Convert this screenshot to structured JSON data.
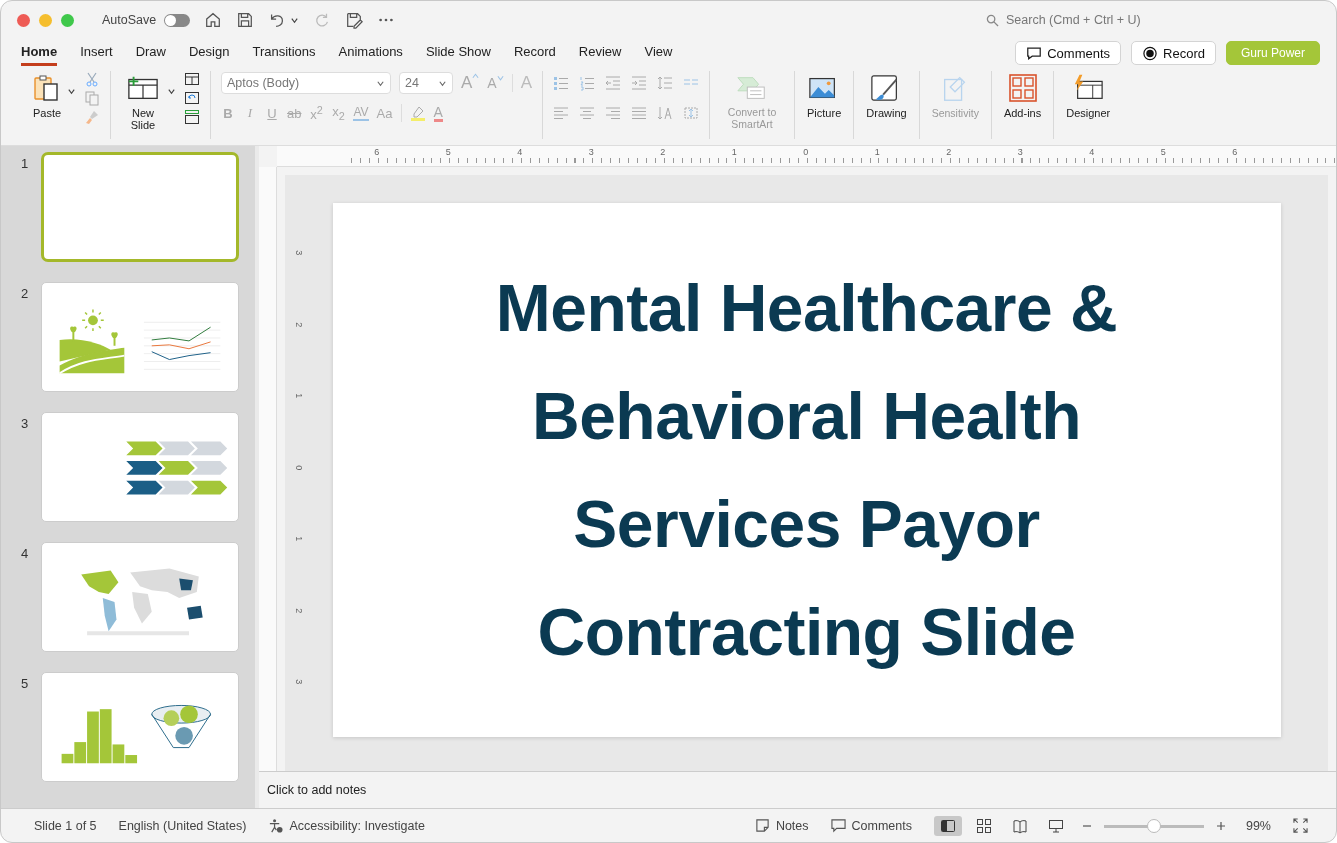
{
  "window": {
    "autosave_label": "AutoSave",
    "autosave_on": false,
    "search_placeholder": "Search (Cmd + Ctrl + U)"
  },
  "tabs": [
    {
      "label": "Home",
      "selected": true
    },
    {
      "label": "Insert",
      "selected": false
    },
    {
      "label": "Draw",
      "selected": false
    },
    {
      "label": "Design",
      "selected": false
    },
    {
      "label": "Transitions",
      "selected": false
    },
    {
      "label": "Animations",
      "selected": false
    },
    {
      "label": "Slide Show",
      "selected": false
    },
    {
      "label": "Record",
      "selected": false
    },
    {
      "label": "Review",
      "selected": false
    },
    {
      "label": "View",
      "selected": false
    }
  ],
  "header_buttons": [
    {
      "label": "Comments",
      "kind": "comments"
    },
    {
      "label": "Record",
      "kind": "record"
    },
    {
      "label": "Guru Power",
      "kind": "primary"
    }
  ],
  "ribbon": {
    "paste": "Paste",
    "new_slide": "New Slide",
    "font": "Aptos (Body)",
    "font_size": "24",
    "font_buttons": [
      {
        "label": "B",
        "kind": "bold"
      },
      {
        "label": "I",
        "kind": "italic"
      },
      {
        "label": "U",
        "kind": "underline"
      },
      {
        "label": "ab",
        "kind": "strike"
      },
      {
        "label": "x$^{2}$",
        "kind": "plain"
      },
      {
        "label": "x$_{2}$",
        "kind": "plain"
      },
      {
        "label": "AV",
        "kind": "spacing"
      },
      {
        "label": "Aa",
        "kind": "case"
      }
    ],
    "grow": "A",
    "shrink": "A",
    "clear": "A",
    "font_color": "A",
    "convert": "Convert to SmartArt",
    "convert_disabled": true,
    "big_buttons": [
      {
        "label": "Picture",
        "kind": "picture",
        "disabled": false
      },
      {
        "label": "Drawing",
        "kind": "drawing",
        "disabled": false
      },
      {
        "label": "Sensitivity",
        "kind": "sensitivity",
        "disabled": true
      },
      {
        "label": "Add-ins",
        "kind": "addins",
        "disabled": false
      },
      {
        "label": "Designer",
        "kind": "designer",
        "disabled": false
      }
    ]
  },
  "slides": [
    {
      "number": "1",
      "selected": true,
      "kind": "blank"
    },
    {
      "number": "2",
      "selected": false,
      "kind": "landscape"
    },
    {
      "number": "3",
      "selected": false,
      "kind": "chevrons"
    },
    {
      "number": "4",
      "selected": false,
      "kind": "map"
    },
    {
      "number": "5",
      "selected": false,
      "kind": "funnel"
    }
  ],
  "ruler": {
    "horizontal": [
      "6",
      "5",
      "4",
      "3",
      "2",
      "1",
      "0",
      "1",
      "2",
      "3",
      "4",
      "5",
      "6"
    ],
    "vertical": [
      "3",
      "2",
      "1",
      "0",
      "1",
      "2",
      "3"
    ]
  },
  "slide": {
    "title": "Mental Healthcare & Behavioral Health Services Payor Contracting Slide"
  },
  "notes": {
    "placeholder": "Click to add notes"
  },
  "status_bar": {
    "slide_info": "Slide 1 of 5",
    "language": "English (United States)",
    "accessibility": "Accessibility: Investigate",
    "notes": "Notes",
    "comments": "Comments",
    "views": [
      {
        "kind": "normal",
        "selected": true
      },
      {
        "kind": "sorter",
        "selected": false
      },
      {
        "kind": "reading",
        "selected": false
      },
      {
        "kind": "show",
        "selected": false
      }
    ],
    "zoom": {
      "level": 0.5,
      "reading": "99%"
    }
  }
}
